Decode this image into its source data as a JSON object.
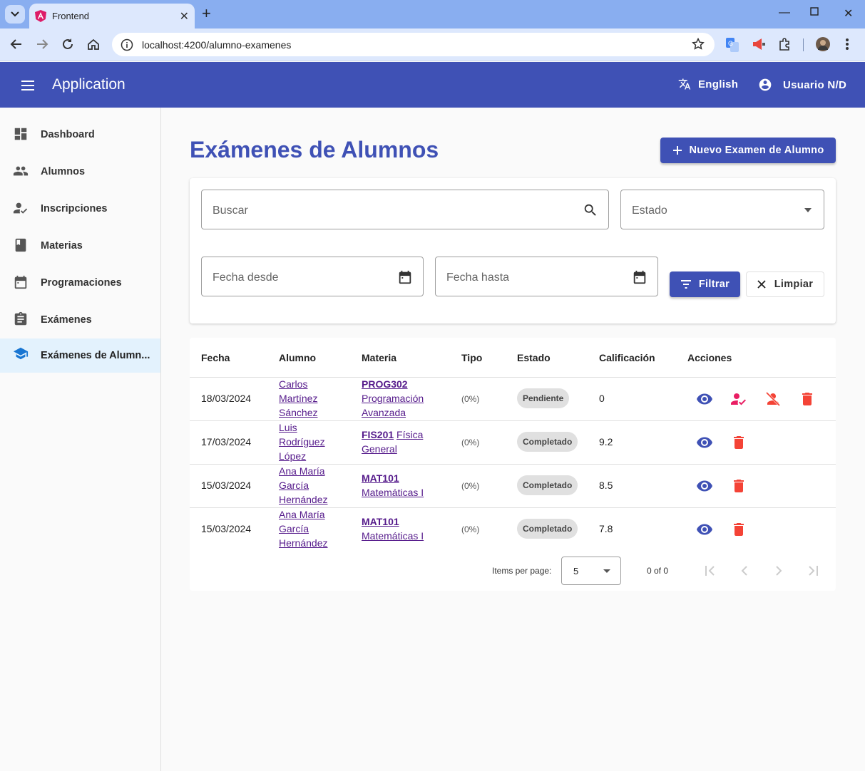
{
  "browser": {
    "tab_title": "Frontend",
    "url": "localhost:4200/alumno-examenes"
  },
  "toolbar": {
    "title": "Application",
    "language": "English",
    "user": "Usuario N/D"
  },
  "sidebar": {
    "items": [
      {
        "label": "Dashboard",
        "icon": "dashboard-icon"
      },
      {
        "label": "Alumnos",
        "icon": "people-icon"
      },
      {
        "label": "Inscripciones",
        "icon": "how-to-reg-icon"
      },
      {
        "label": "Materias",
        "icon": "book-icon"
      },
      {
        "label": "Programaciones",
        "icon": "calendar-icon"
      },
      {
        "label": "Exámenes",
        "icon": "assignment-icon"
      },
      {
        "label": "Exámenes de Alumn...",
        "icon": "school-icon",
        "active": true
      }
    ]
  },
  "page": {
    "title": "Exámenes de Alumnos",
    "new_button": "Nuevo Examen de Alumno"
  },
  "filters": {
    "search_placeholder": "Buscar",
    "estado_placeholder": "Estado",
    "fecha_desde_placeholder": "Fecha desde",
    "fecha_hasta_placeholder": "Fecha hasta",
    "filter_button": "Filtrar",
    "clear_button": "Limpiar"
  },
  "table": {
    "headers": [
      "Fecha",
      "Alumno",
      "Materia",
      "Tipo",
      "Estado",
      "Calificación",
      "Acciones"
    ],
    "rows": [
      {
        "fecha": "18/03/2024",
        "alumno": [
          "Carlos",
          "Martínez",
          "Sánchez"
        ],
        "materia_code": "PROG302",
        "materia_name": [
          "Programación",
          "Avanzada"
        ],
        "tipo": "(0%)",
        "estado": "Pendiente",
        "calificacion": "0"
      },
      {
        "fecha": "17/03/2024",
        "alumno": [
          "Luis",
          "Rodríguez",
          "López"
        ],
        "materia_code": "FIS201",
        "materia_name": [
          "Física",
          "General"
        ],
        "tipo": "(0%)",
        "estado": "Completado",
        "calificacion": "9.2"
      },
      {
        "fecha": "15/03/2024",
        "alumno": [
          "Ana María",
          "García",
          "Hernández"
        ],
        "materia_code": "MAT101",
        "materia_name": [
          "Matemáticas I"
        ],
        "tipo": "(0%)",
        "estado": "Completado",
        "calificacion": "8.5"
      },
      {
        "fecha": "15/03/2024",
        "alumno": [
          "Ana María",
          "García",
          "Hernández"
        ],
        "materia_code": "MAT101",
        "materia_name": [
          "Matemáticas I"
        ],
        "tipo": "(0%)",
        "estado": "Completado",
        "calificacion": "7.8"
      }
    ]
  },
  "paginator": {
    "items_per_page_label": "Items per page:",
    "page_size": "5",
    "range": "0 of 0"
  },
  "colors": {
    "primary": "#3f51b5",
    "view_icon": "#3f51b5",
    "assign_icon": "#e91e63",
    "danger": "#f44336"
  }
}
